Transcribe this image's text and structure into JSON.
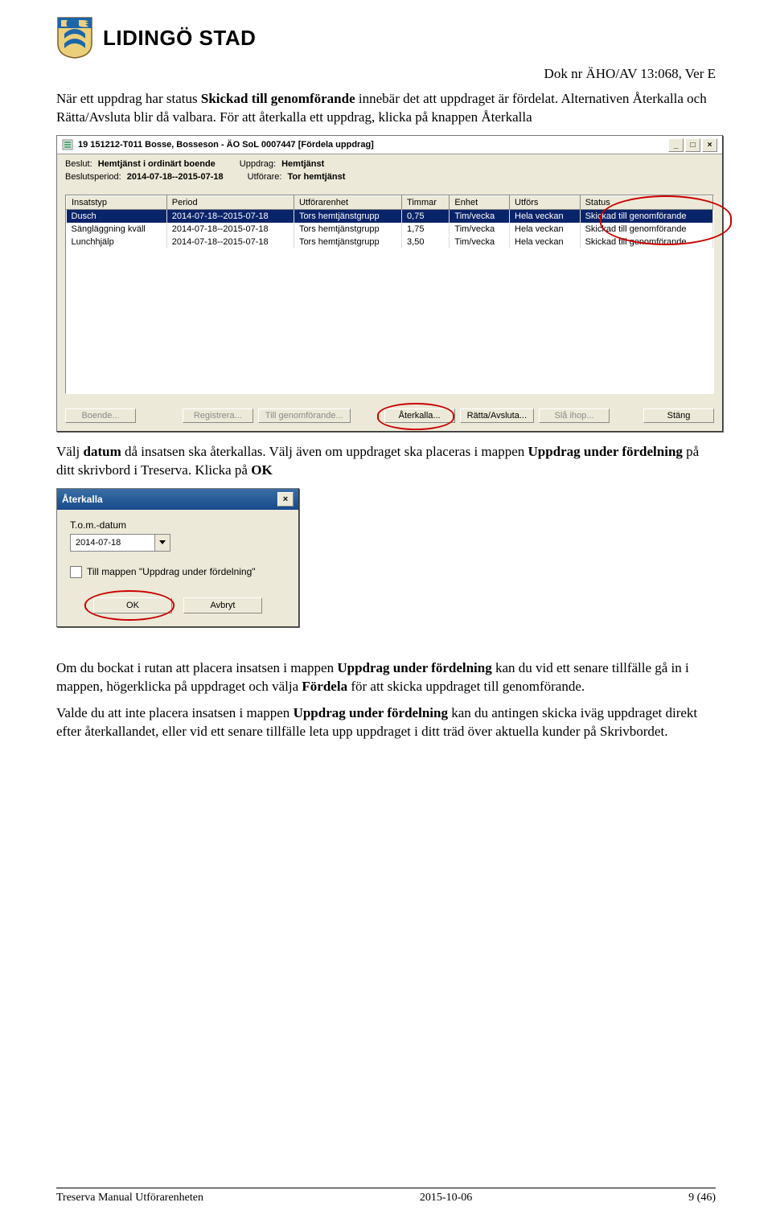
{
  "header": {
    "brand": "LIDINGÖ STAD",
    "docid": "Dok nr ÄHO/AV 13:068, Ver E"
  },
  "para1_a": "När ett uppdrag har status ",
  "para1_b": "Skickad till genomförande",
  "para1_c": " innebär det att uppdraget är fördelat. Alternativen Återkalla och Rätta/Avsluta blir då valbara. För att återkalla ett uppdrag, klicka på knappen Återkalla",
  "win1": {
    "title": "19 151212-T011  Bosse, Bosseson  -  ÄO SoL  0007447  [Fördela uppdrag]",
    "meta1": {
      "beslut_lbl": "Beslut:",
      "beslut_val": "Hemtjänst i ordinärt boende",
      "uppdrag_lbl": "Uppdrag:",
      "uppdrag_val": "Hemtjänst"
    },
    "meta2": {
      "period_lbl": "Beslutsperiod:",
      "period_val": "2014-07-18--2015-07-18",
      "utforare_lbl": "Utförare:",
      "utforare_val": "Tor hemtjänst"
    },
    "headers": [
      "Insatstyp",
      "Period",
      "Utförarenhet",
      "Timmar",
      "Enhet",
      "Utförs",
      "Status"
    ],
    "rows": [
      {
        "sel": true,
        "c": [
          "Dusch",
          "2014-07-18--2015-07-18",
          "Tors hemtjänstgrupp",
          "0,75",
          "Tim/vecka",
          "Hela veckan",
          "Skickad till genomförande"
        ]
      },
      {
        "sel": false,
        "c": [
          "Sängläggning kväll",
          "2014-07-18--2015-07-18",
          "Tors hemtjänstgrupp",
          "1,75",
          "Tim/vecka",
          "Hela veckan",
          "Skickad till genomförande"
        ]
      },
      {
        "sel": false,
        "c": [
          "Lunchhjälp",
          "2014-07-18--2015-07-18",
          "Tors hemtjänstgrupp",
          "3,50",
          "Tim/vecka",
          "Hela veckan",
          "Skickad till genomförande"
        ]
      }
    ],
    "buttons": {
      "boende": "Boende...",
      "registrera": "Registrera...",
      "till_genomforande": "Till genomförande...",
      "aterkalla": "Återkalla...",
      "ratta": "Rätta/Avsluta...",
      "sla_ihop": "Slå ihop...",
      "stang": "Stäng"
    }
  },
  "para2_a": "Välj ",
  "para2_b": "datum",
  "para2_c": " då insatsen ska återkallas. Välj även om uppdraget ska placeras i mappen ",
  "para2_d": "Uppdrag under fördelning",
  "para2_e": " på ditt skrivbord i Treserva. Klicka på ",
  "para2_f": "OK",
  "win2": {
    "title": "Återkalla",
    "tom_lbl": "T.o.m.-datum",
    "tom_val": "2014-07-18",
    "chk_lbl": "Till mappen \"Uppdrag under fördelning\"",
    "ok": "OK",
    "cancel": "Avbryt"
  },
  "para3_a": "Om du bockat i rutan att placera insatsen i mappen ",
  "para3_b": "Uppdrag under fördelning",
  "para3_c": " kan du vid ett senare tillfälle gå in i mappen, högerklicka på uppdraget och välja ",
  "para3_d": "Fördela",
  "para3_e": " för att skicka uppdraget till genomförande.",
  "para4_a": "Valde du att inte placera insatsen i mappen ",
  "para4_b": "Uppdrag under fördelning",
  "para4_c": " kan du antingen skicka iväg uppdraget direkt efter återkallandet, eller vid ett senare tillfälle leta upp uppdraget i ditt träd över aktuella kunder på Skrivbordet.",
  "footer": {
    "left": "Treserva Manual Utförarenheten",
    "mid": "2015-10-06",
    "right": "9 (46)"
  }
}
